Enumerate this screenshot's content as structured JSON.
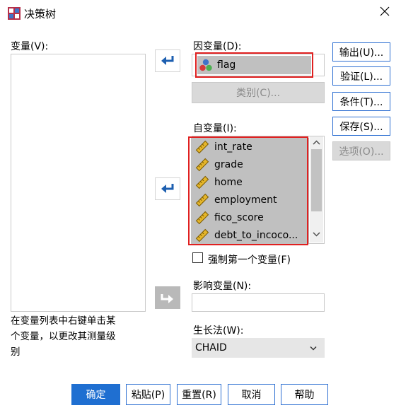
{
  "window": {
    "title": "决策树"
  },
  "variables_label": "变量(V):",
  "hint_text_line1": "在变量列表中右键单击某",
  "hint_text_line2": "个变量，以更改其测量级",
  "hint_text_line3": "别",
  "dependent": {
    "label": "因变量(D):",
    "value": "flag",
    "category_button": "类别(C)..."
  },
  "independent": {
    "label": "自变量(I):",
    "items": [
      "int_rate",
      "grade",
      "home",
      "employment",
      "fico_score",
      "debt_to_incoco..."
    ],
    "force_first_label": "强制第一个变量(F)"
  },
  "influence": {
    "label": "影响变量(N):",
    "value": ""
  },
  "growth": {
    "label": "生长法(W):",
    "selected": "CHAID"
  },
  "side_buttons": [
    "输出(U)...",
    "验证(L)...",
    "条件(T)...",
    "保存(S)...",
    "选项(O)..."
  ],
  "bottom_buttons": [
    "确定",
    "粘贴(P)",
    "重置(R)",
    "取消",
    "帮助"
  ],
  "colors": {
    "accent": "#1f6fd1",
    "highlight": "#c0c0c0",
    "red": "#e02020"
  },
  "icons": {
    "close": "close-icon",
    "arrow": "arrow-left-icon",
    "scale": "scale-ruler-icon",
    "nominal": "nominal-icon"
  }
}
